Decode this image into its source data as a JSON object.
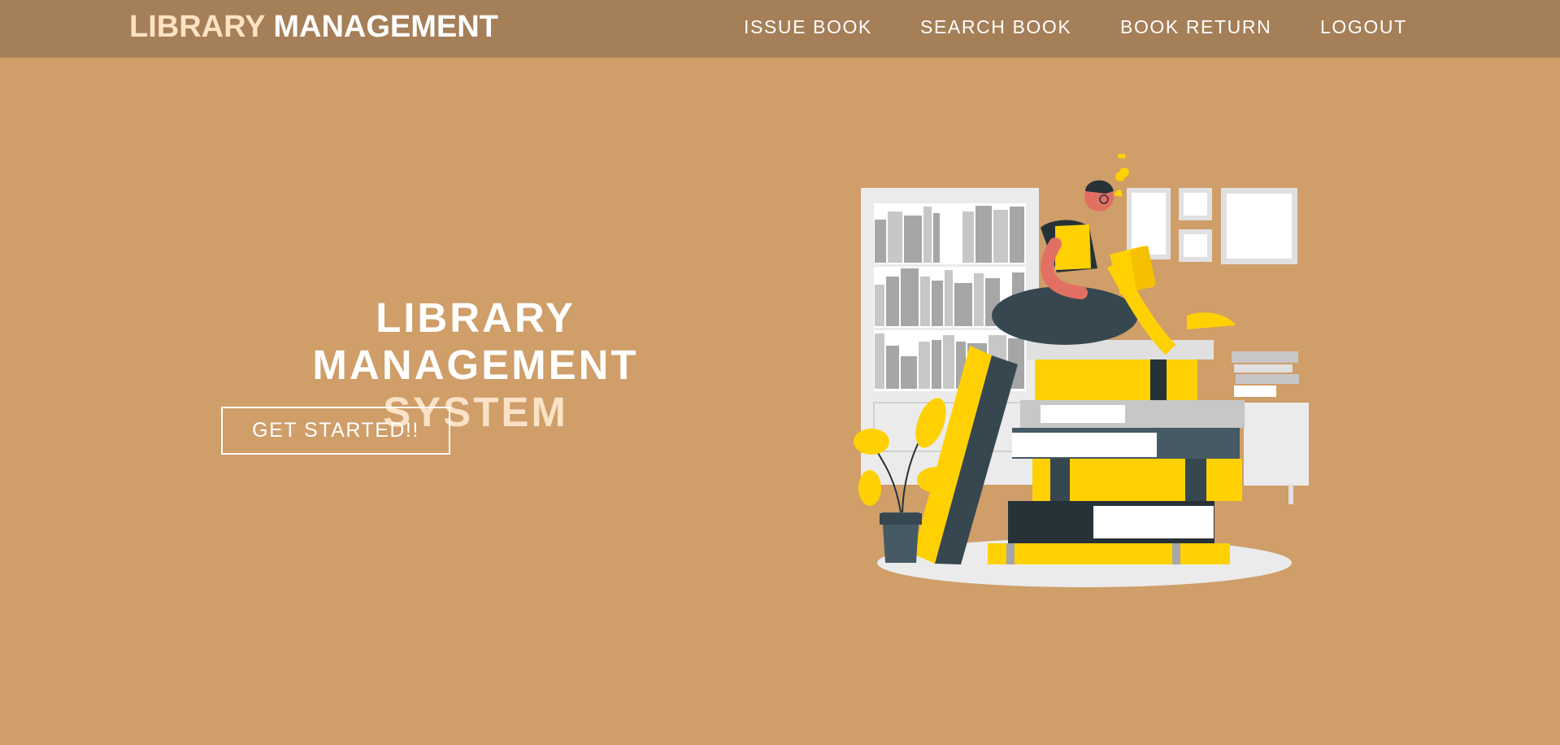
{
  "brand": {
    "part1": "LIBRARY",
    "part2": "MANAGEMENT"
  },
  "nav": {
    "issue": "ISSUE BOOK",
    "search": "SEARCH BOOK",
    "return": "BOOK RETURN",
    "logout": "LOGOUT"
  },
  "hero": {
    "line1": "LIBRARY",
    "line2_main": "MANAGEMENT",
    "line2_accent": "SYSTEM",
    "cta": "GET STARTED!!"
  },
  "colors": {
    "background": "#CF9E69",
    "navbar": "#A57F58",
    "brand_accent": "#FFE2C2",
    "title_accent": "#FBE2C6",
    "illustration_yellow": "#FFD103",
    "illustration_dark": "#37474F",
    "illustration_skin": "#E27062"
  },
  "illustration": {
    "icon": "reading-person-on-books-illustration"
  }
}
